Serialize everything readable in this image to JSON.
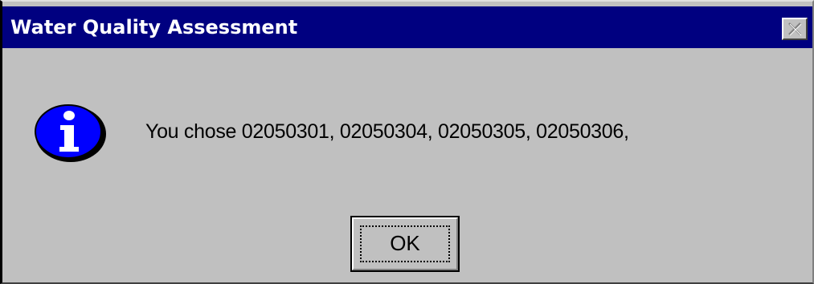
{
  "window": {
    "title": "Water Quality Assessment",
    "close_icon": "close-icon",
    "title_bar_color": "#000080",
    "body_color": "#c0c0c0"
  },
  "message": {
    "icon": "info-icon",
    "text": "You chose  02050301, 02050304, 02050305, 02050306,"
  },
  "buttons": {
    "ok_label": "OK"
  }
}
